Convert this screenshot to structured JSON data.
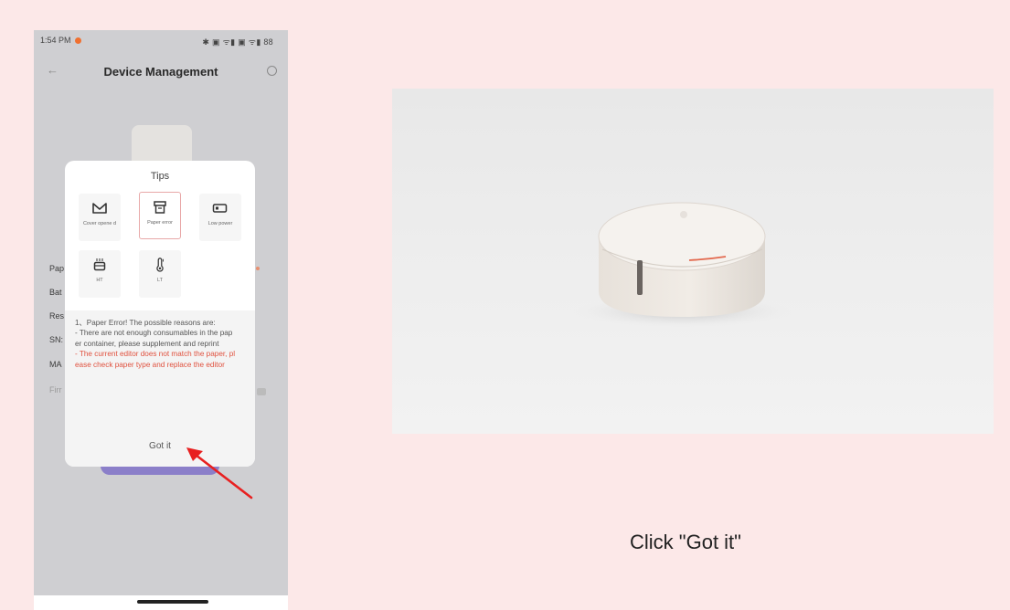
{
  "status_bar": {
    "time": "1:54 PM",
    "icons_text": "✱ ▣ ᯤ▮ ▣ ᯤ▮ 88"
  },
  "header": {
    "title": "Device Management"
  },
  "background_labels": [
    "Pap",
    "Bat",
    "Res",
    "SN:",
    "MA",
    "Firr"
  ],
  "dialog": {
    "title": "Tips",
    "tiles": [
      {
        "label": "Cover opene d",
        "icon": "cover-open-icon"
      },
      {
        "label": "Paper error",
        "icon": "paper-error-icon",
        "selected": true
      },
      {
        "label": "Low power",
        "icon": "low-power-icon"
      },
      {
        "label": "HT",
        "icon": "high-temperature-icon"
      },
      {
        "label": "LT",
        "icon": "low-temperature-icon"
      }
    ],
    "message_heading": "1、Paper Error! The possible reasons are:",
    "message_black": "- There are not enough consumables in the paper container, please supplement and reprint",
    "message_red": "- The current editor does not match the paper, please check paper type and replace the editor",
    "accent_color": "#e0513e",
    "confirm_label": "Got it"
  },
  "caption": "Click \"Got it\""
}
